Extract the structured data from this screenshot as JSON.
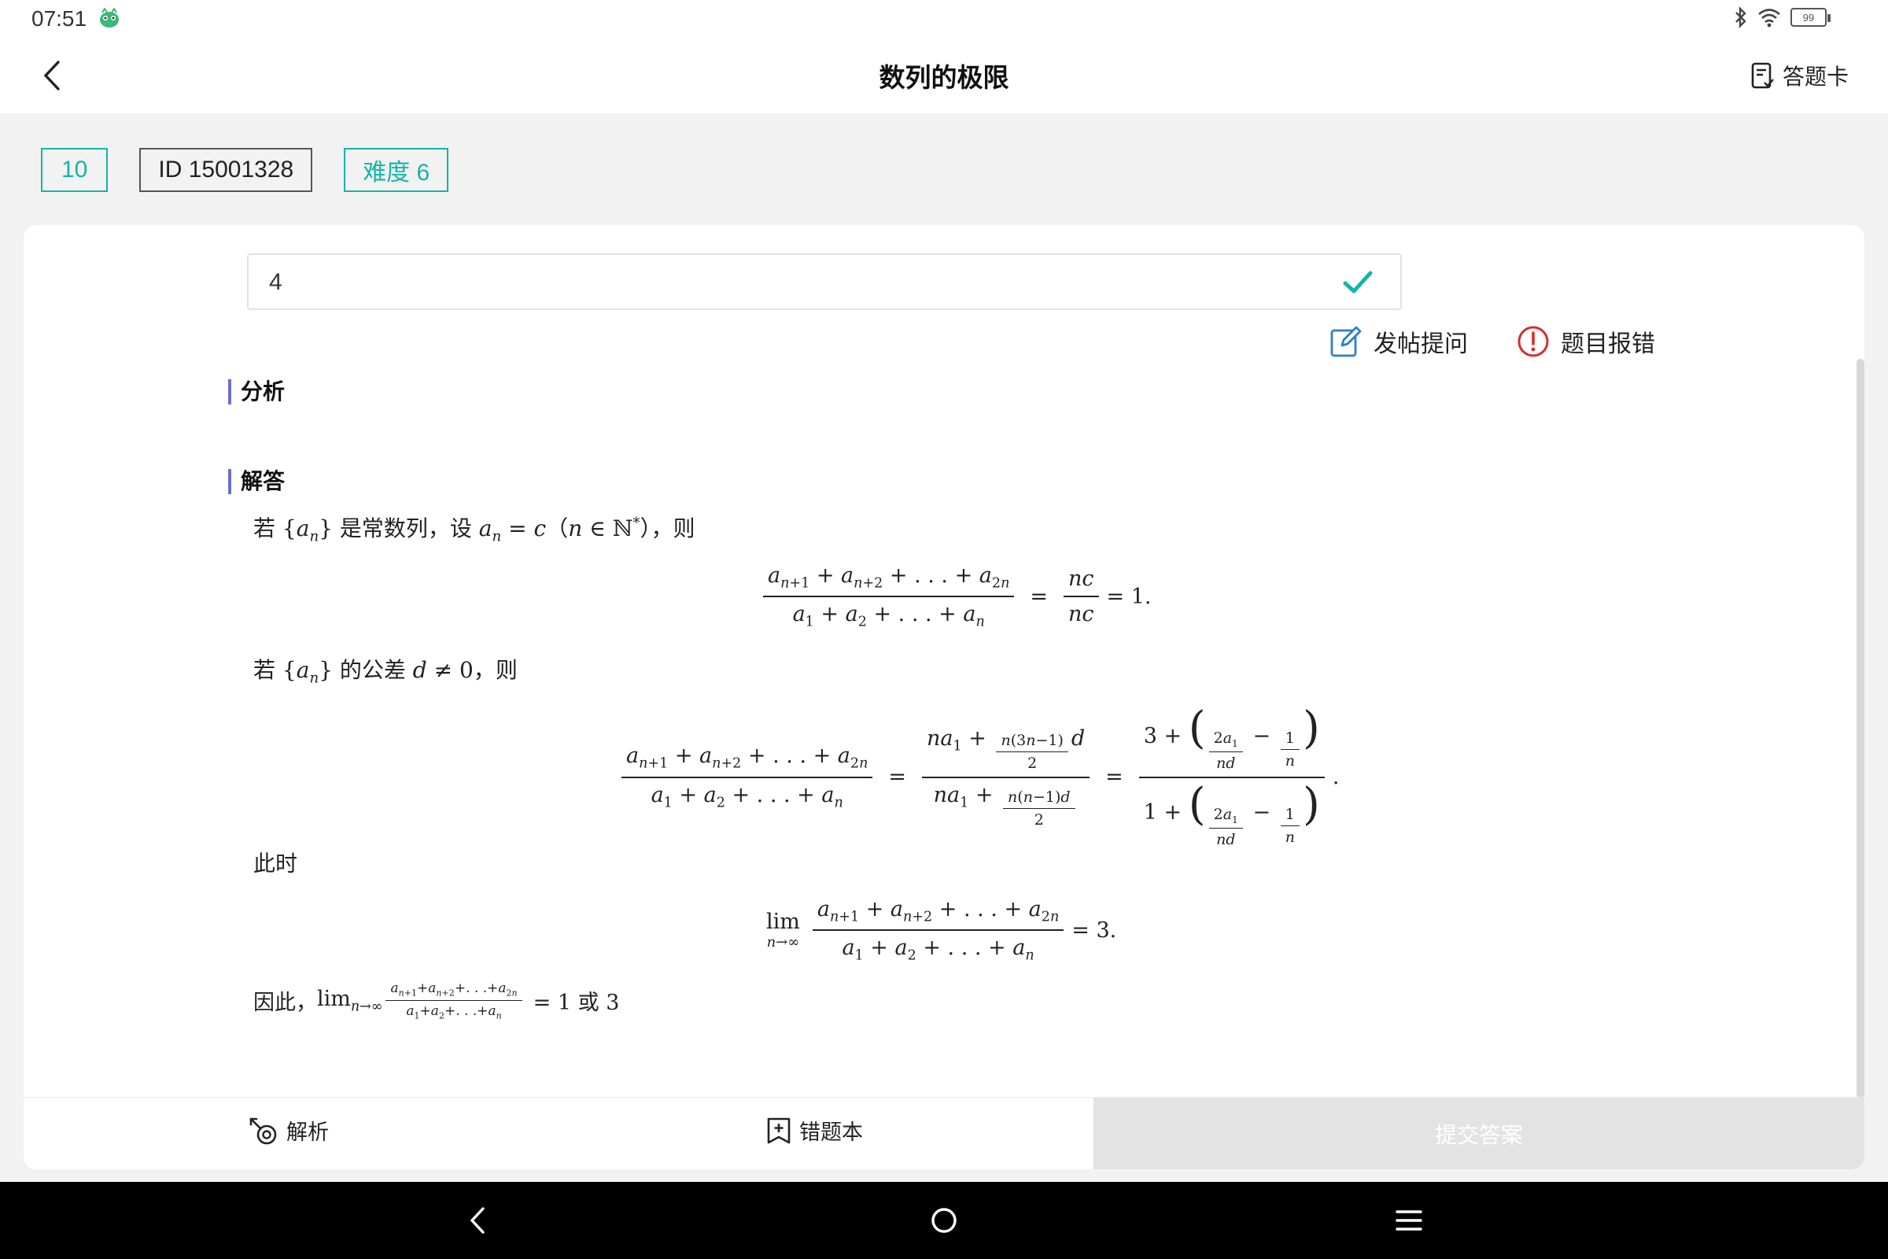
{
  "status_bar": {
    "time": "07:51",
    "battery": "99"
  },
  "header": {
    "title": "数列的极限",
    "answer_card_label": "答题卡"
  },
  "tags": {
    "number": "10",
    "id": "ID 15001328",
    "difficulty": "难度 6"
  },
  "answer": {
    "value": "4"
  },
  "actions": {
    "post_question": "发帖提问",
    "report_error": "题目报错"
  },
  "sections": {
    "analysis": "分析",
    "solution": "解答"
  },
  "solution": {
    "line1_prefix": "若",
    "line1_seq": "{a",
    "line1_mid": "是常数列，设",
    "line1_cond": "则",
    "line2_prefix": "若",
    "line2_mid": "的公差",
    "line2_suffix": "则",
    "line3": "此时",
    "line4_prefix": "因此，",
    "line4_result": "= 1 或 3",
    "eq1_result": "= 1.",
    "eq3_result": "= 3."
  },
  "bottom_bar": {
    "analysis": "解析",
    "wrong_book": "错题本",
    "submit": "提交答案"
  },
  "colors": {
    "accent": "#13b5a8",
    "section_bar": "#6a6fc8",
    "report": "#d32f2f",
    "edit": "#2e7dd1"
  }
}
